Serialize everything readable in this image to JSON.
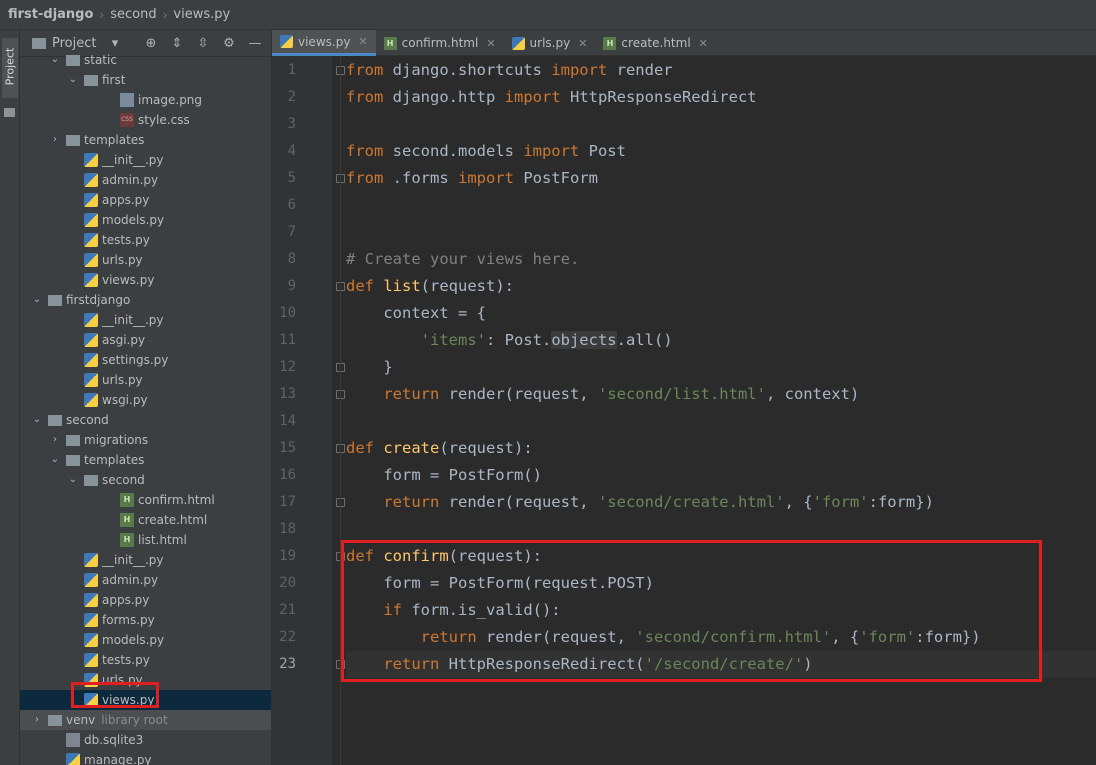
{
  "breadcrumb": [
    "first-django",
    "second",
    "views.py"
  ],
  "side_strip_label": "Project",
  "project_panel": {
    "title": "Project",
    "tree": [
      {
        "label": "static",
        "type": "folder",
        "indent": 2,
        "arrow": "open"
      },
      {
        "label": "first",
        "type": "folder",
        "indent": 3,
        "arrow": "open"
      },
      {
        "label": "image.png",
        "type": "png",
        "indent": 5
      },
      {
        "label": "style.css",
        "type": "css",
        "indent": 5
      },
      {
        "label": "templates",
        "type": "folder",
        "indent": 2,
        "arrow": "closed"
      },
      {
        "label": "__init__.py",
        "type": "py",
        "indent": 3
      },
      {
        "label": "admin.py",
        "type": "py",
        "indent": 3
      },
      {
        "label": "apps.py",
        "type": "py",
        "indent": 3
      },
      {
        "label": "models.py",
        "type": "py",
        "indent": 3
      },
      {
        "label": "tests.py",
        "type": "py",
        "indent": 3
      },
      {
        "label": "urls.py",
        "type": "py",
        "indent": 3
      },
      {
        "label": "views.py",
        "type": "py",
        "indent": 3
      },
      {
        "label": "firstdjango",
        "type": "folder",
        "indent": 1,
        "arrow": "open"
      },
      {
        "label": "__init__.py",
        "type": "py",
        "indent": 3
      },
      {
        "label": "asgi.py",
        "type": "py",
        "indent": 3
      },
      {
        "label": "settings.py",
        "type": "py",
        "indent": 3
      },
      {
        "label": "urls.py",
        "type": "py",
        "indent": 3
      },
      {
        "label": "wsgi.py",
        "type": "py",
        "indent": 3
      },
      {
        "label": "second",
        "type": "folder",
        "indent": 1,
        "arrow": "open"
      },
      {
        "label": "migrations",
        "type": "folder",
        "indent": 2,
        "arrow": "closed"
      },
      {
        "label": "templates",
        "type": "folder",
        "indent": 2,
        "arrow": "open"
      },
      {
        "label": "second",
        "type": "folder",
        "indent": 3,
        "arrow": "open"
      },
      {
        "label": "confirm.html",
        "type": "html",
        "indent": 5
      },
      {
        "label": "create.html",
        "type": "html",
        "indent": 5
      },
      {
        "label": "list.html",
        "type": "html",
        "indent": 5
      },
      {
        "label": "__init__.py",
        "type": "py",
        "indent": 3
      },
      {
        "label": "admin.py",
        "type": "py",
        "indent": 3
      },
      {
        "label": "apps.py",
        "type": "py",
        "indent": 3
      },
      {
        "label": "forms.py",
        "type": "py",
        "indent": 3
      },
      {
        "label": "models.py",
        "type": "py",
        "indent": 3
      },
      {
        "label": "tests.py",
        "type": "py",
        "indent": 3
      },
      {
        "label": "urls.py",
        "type": "py",
        "indent": 3
      },
      {
        "label": "views.py",
        "type": "py",
        "indent": 3,
        "selected": true
      },
      {
        "label": "venv",
        "type": "folder",
        "indent": 1,
        "arrow": "closed",
        "suffix": "library root",
        "highlight": true
      },
      {
        "label": "db.sqlite3",
        "type": "db",
        "indent": 2
      },
      {
        "label": "manage.py",
        "type": "py",
        "indent": 2
      }
    ]
  },
  "tabs": [
    {
      "label": "views.py",
      "icon": "py",
      "active": true
    },
    {
      "label": "confirm.html",
      "icon": "html"
    },
    {
      "label": "urls.py",
      "icon": "py"
    },
    {
      "label": "create.html",
      "icon": "html"
    }
  ],
  "code": [
    {
      "n": "1",
      "tokens": [
        {
          "t": "from",
          "c": "k"
        },
        {
          "t": " django.shortcuts "
        },
        {
          "t": "import",
          "c": "k"
        },
        {
          "t": " render"
        }
      ],
      "fold": true
    },
    {
      "n": "2",
      "tokens": [
        {
          "t": "from",
          "c": "k"
        },
        {
          "t": " django.http "
        },
        {
          "t": "import",
          "c": "k"
        },
        {
          "t": " HttpResponseRedirect"
        }
      ]
    },
    {
      "n": "3",
      "tokens": []
    },
    {
      "n": "4",
      "tokens": [
        {
          "t": "from",
          "c": "k"
        },
        {
          "t": " second.models "
        },
        {
          "t": "import",
          "c": "k"
        },
        {
          "t": " Post"
        }
      ]
    },
    {
      "n": "5",
      "tokens": [
        {
          "t": "from",
          "c": "k"
        },
        {
          "t": " .forms "
        },
        {
          "t": "import",
          "c": "k"
        },
        {
          "t": " PostForm"
        }
      ],
      "fold": true
    },
    {
      "n": "6",
      "tokens": []
    },
    {
      "n": "7",
      "tokens": []
    },
    {
      "n": "8",
      "tokens": [
        {
          "t": "# Create your views here.",
          "c": "c"
        }
      ]
    },
    {
      "n": "9",
      "tokens": [
        {
          "t": "def",
          "c": "k"
        },
        {
          "t": " "
        },
        {
          "t": "list",
          "c": "f"
        },
        {
          "t": "(request):"
        }
      ],
      "fold": true
    },
    {
      "n": "10",
      "tokens": [
        {
          "t": "    context = {"
        }
      ]
    },
    {
      "n": "11",
      "tokens": [
        {
          "t": "        "
        },
        {
          "t": "'items'",
          "c": "s"
        },
        {
          "t": ": Post."
        },
        {
          "t": "objects",
          "c": "hl"
        },
        {
          "t": ".all()"
        }
      ]
    },
    {
      "n": "12",
      "tokens": [
        {
          "t": "    }"
        }
      ],
      "fold": true
    },
    {
      "n": "13",
      "tokens": [
        {
          "t": "    "
        },
        {
          "t": "return",
          "c": "k"
        },
        {
          "t": " render(request, "
        },
        {
          "t": "'second/list.html'",
          "c": "s"
        },
        {
          "t": ", context)"
        }
      ],
      "fold": true
    },
    {
      "n": "14",
      "tokens": []
    },
    {
      "n": "15",
      "tokens": [
        {
          "t": "def",
          "c": "k"
        },
        {
          "t": " "
        },
        {
          "t": "create",
          "c": "f"
        },
        {
          "t": "(request):"
        }
      ],
      "fold": true
    },
    {
      "n": "16",
      "tokens": [
        {
          "t": "    form = PostForm()"
        }
      ]
    },
    {
      "n": "17",
      "tokens": [
        {
          "t": "    "
        },
        {
          "t": "return",
          "c": "k"
        },
        {
          "t": " render(request, "
        },
        {
          "t": "'second/create.html'",
          "c": "s"
        },
        {
          "t": ", {"
        },
        {
          "t": "'form'",
          "c": "s"
        },
        {
          "t": ":form})"
        }
      ],
      "fold": true
    },
    {
      "n": "18",
      "tokens": []
    },
    {
      "n": "19",
      "tokens": [
        {
          "t": "def",
          "c": "k"
        },
        {
          "t": " "
        },
        {
          "t": "confirm",
          "c": "f"
        },
        {
          "t": "(request):"
        }
      ],
      "fold": true
    },
    {
      "n": "20",
      "tokens": [
        {
          "t": "    form = PostForm(request.POST)"
        }
      ]
    },
    {
      "n": "21",
      "tokens": [
        {
          "t": "    "
        },
        {
          "t": "if",
          "c": "k"
        },
        {
          "t": " form.is_valid():"
        }
      ]
    },
    {
      "n": "22",
      "tokens": [
        {
          "t": "        "
        },
        {
          "t": "return",
          "c": "k"
        },
        {
          "t": " render(request, "
        },
        {
          "t": "'second/confirm.html'",
          "c": "s"
        },
        {
          "t": ", {"
        },
        {
          "t": "'form'",
          "c": "s"
        },
        {
          "t": ":form})"
        }
      ]
    },
    {
      "n": "23",
      "tokens": [
        {
          "t": "    "
        },
        {
          "t": "return",
          "c": "k"
        },
        {
          "t": " HttpResponseRedirect("
        },
        {
          "t": "'/second/create/'",
          "c": "s"
        },
        {
          "t": ")"
        }
      ],
      "fold": true,
      "current": true
    }
  ],
  "colors": {
    "keyword": "#cc7832",
    "string": "#6a8759",
    "comment": "#808080",
    "function": "#ffc66d",
    "callout": "#e02020"
  }
}
